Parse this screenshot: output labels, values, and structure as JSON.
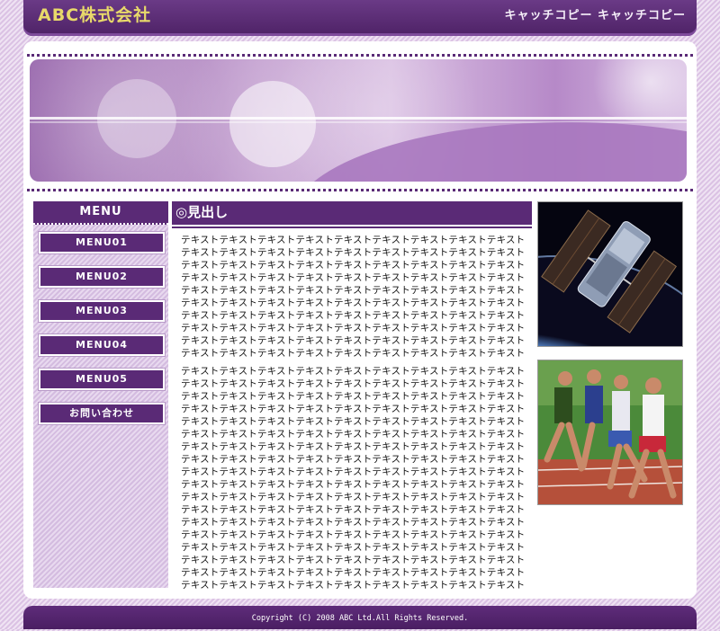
{
  "header": {
    "logo": "ABC株式会社",
    "catch_copy": "キャッチコピー キャッチコピー"
  },
  "sidebar": {
    "menu_title": "MENU",
    "items": [
      {
        "label": "MENU01"
      },
      {
        "label": "MENU02"
      },
      {
        "label": "MENU03"
      },
      {
        "label": "MENU04"
      },
      {
        "label": "MENU05"
      },
      {
        "label": "お問い合わせ"
      }
    ]
  },
  "main": {
    "heading": "◎見出し",
    "paragraph1": "テキストテキストテキストテキストテキストテキストテキストテキストテキストテキストテキストテキストテキストテキストテキストテキストテキストテキストテキストテキストテキストテキストテキストテキストテキストテキストテキストテキストテキストテキストテキストテキストテキストテキストテキストテキストテキストテキストテキストテキストテキストテキストテキストテキストテキストテキストテキストテキストテキストテキストテキストテキストテキストテキストテキストテキストテキストテキストテキストテキストテキストテキストテキストテキストテキストテキストテキストテキストテキストテキストテキストテキストテキストテキストテキストテキストテキストテキストテキストテキストテキストテキストテキストテキストテキストテキストテキストテキストテキストテキストテキストテキストテキストテキストテキストテキストテキストテキストテキストテキスト",
    "paragraph2": "テキストテキストテキストテキストテキストテキストテキストテキストテキストテキストテキストテキストテキストテキストテキストテキストテキストテキストテキストテキストテキストテキストテキストテキストテキストテキストテキストテキストテキストテキストテキストテキストテキストテキストテキストテキストテキストテキストテキストテキストテキストテキストテキストテキストテキストテキストテキストテキストテキストテキストテキストテキストテキストテキストテキストテキストテキストテキストテキストテキストテキストテキストテキストテキストテキストテキストテキストテキストテキストテキストテキストテキストテキストテキストテキストテキストテキストテキストテキストテキストテキストテキストテキストテキストテキストテキストテキストテキストテキストテキストテキストテキストテキストテキストテキストテキストテキストテキストテキストテキストテキストテキストテキストテキストテキストテキストテキストテキストテキストテキストテキストテキストテキストテキストテキストテキストテキストテキストテキストテキストテキストテキストテキストテキストテキストテキストテキストテキストテキストテキストテキストテキストテキストテキストテキストテキストテキストテキストテキストテキストテキストテキストテキストテキストテキストテキストテキストテキストテキストテキストテキストテキストテキストテキストテキストテキストテキストテキストテキストテキストテキストテキストテキストテキストテキストテキストテキストテキストテキストテキストテキストテキストテキストテキストテキストテキストテキストテキストテキストテキストテキスト"
  },
  "photos": [
    {
      "icon": "satellite-photo"
    },
    {
      "icon": "runners-photo"
    }
  ],
  "footer": {
    "copyright": "Copyright (C) 2008 ABC Ltd.All Rights Reserved."
  },
  "colors": {
    "brand_purple": "#5a2a76",
    "logo_gold": "#e8d96a"
  }
}
